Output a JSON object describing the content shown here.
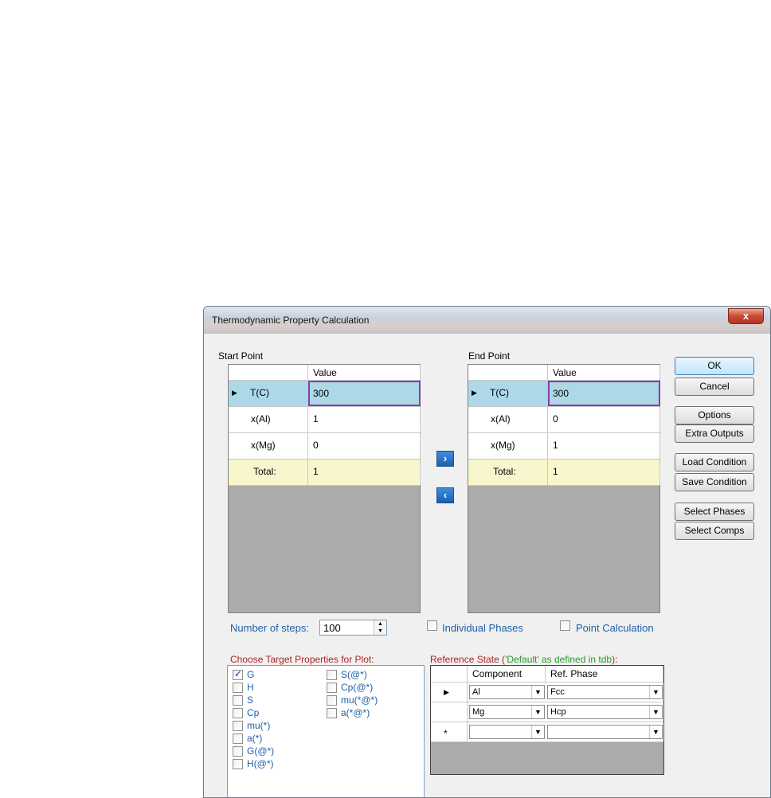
{
  "window": {
    "title": "Thermodynamic Property Calculation",
    "close_label": "x"
  },
  "start": {
    "label": "Start Point",
    "value_header": "Value",
    "rows": [
      {
        "name": "T(C)",
        "value": "300"
      },
      {
        "name": "x(Al)",
        "value": "1"
      },
      {
        "name": "x(Mg)",
        "value": "0"
      },
      {
        "name": "Total:",
        "value": "1"
      }
    ]
  },
  "end": {
    "label": "End Point",
    "value_header": "Value",
    "rows": [
      {
        "name": "T(C)",
        "value": "300"
      },
      {
        "name": "x(Al)",
        "value": "0"
      },
      {
        "name": "x(Mg)",
        "value": "1"
      },
      {
        "name": "Total:",
        "value": "1"
      }
    ]
  },
  "arrows": {
    "forward": "›",
    "back": "‹"
  },
  "buttons": {
    "ok": "OK",
    "cancel": "Cancel",
    "options": "Options",
    "extra_outputs": "Extra Outputs",
    "load_condition": "Load Condition",
    "save_condition": "Save Condition",
    "select_phases": "Select Phases",
    "select_comps": "Select Comps"
  },
  "steps": {
    "label": "Number of steps:",
    "value": "100"
  },
  "individual_phases": {
    "label": "Individual Phases",
    "checked": false
  },
  "point_calculation": {
    "label": "Point Calculation",
    "checked": false
  },
  "target_props": {
    "label": "Choose Target Properties for Plot:",
    "col1": [
      {
        "label": "G",
        "checked": true
      },
      {
        "label": "H",
        "checked": false
      },
      {
        "label": "S",
        "checked": false
      },
      {
        "label": "Cp",
        "checked": false
      },
      {
        "label": "mu(*)",
        "checked": false
      },
      {
        "label": "a(*)",
        "checked": false
      },
      {
        "label": "G(@*)",
        "checked": false
      },
      {
        "label": "H(@*)",
        "checked": false
      }
    ],
    "col2": [
      {
        "label": "S(@*)",
        "checked": false
      },
      {
        "label": "Cp(@*)",
        "checked": false
      },
      {
        "label": "mu(*@*)",
        "checked": false
      },
      {
        "label": "a(*@*)",
        "checked": false
      }
    ]
  },
  "reference_state": {
    "label_prefix": "Reference State (",
    "label_default": "'Default' as defined in tdb",
    "label_suffix": "):",
    "headers": [
      "Component",
      "Ref. Phase"
    ],
    "rows": [
      {
        "marker": "▶",
        "component": "Al",
        "phase": "Fcc"
      },
      {
        "marker": "",
        "component": "Mg",
        "phase": "Hcp"
      },
      {
        "marker": "*",
        "component": "",
        "phase": ""
      }
    ]
  },
  "colors": {
    "selected_row": "#acd8e8",
    "total_row": "#f8f6cc",
    "grid_bg": "#ababab"
  }
}
